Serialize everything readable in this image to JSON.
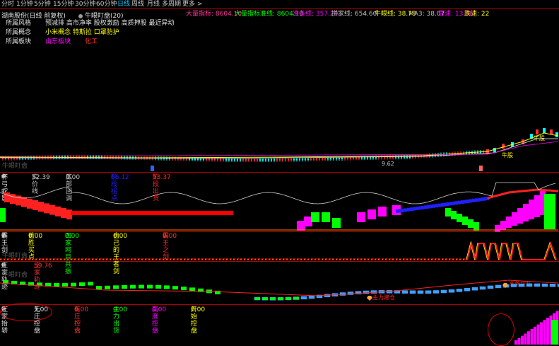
{
  "toolbar": {
    "periods": [
      "分时",
      "1分钟",
      "5分钟",
      "15分钟",
      "30分钟",
      "60分钟",
      "日线",
      "周线",
      "月线",
      "多周期",
      "更多 >"
    ],
    "active": "日线"
  },
  "header": {
    "stock_title": "湖南股份(日线 前复权)",
    "indicator_label": "牛眼盯盘(20)",
    "readouts": [
      {
        "label": "大量指标",
        "value": "8604.10",
        "color": "#ff3399"
      },
      {
        "label": "大量指标准线",
        "value": "8604.10",
        "color": "#00ff00"
      },
      {
        "label": "准备线",
        "value": "357.20",
        "color": "#ff00ff"
      },
      {
        "label": "拼家线",
        "value": "654.60",
        "color": "#c0c0c0"
      },
      {
        "label": "牛眼线",
        "value": "38.78",
        "color": "#ffff00"
      },
      {
        "label": "MA3",
        "value": "38.07",
        "color": "#c0c0c0"
      },
      {
        "label": "涨速",
        "value": "13.76",
        "color": "#ff00ff"
      },
      {
        "label": "跌速",
        "value": "22",
        "color": "#ffff00"
      }
    ]
  },
  "info": {
    "rows": [
      {
        "label": "所属风格",
        "value": "预减排 高市净率 股权激励 高质押股 最近异动",
        "color": "#e0e0e0"
      },
      {
        "label": "所属概念",
        "value": "小米概念 特斯拉 口罩防护",
        "color": "#ffff00"
      },
      {
        "label": "所属板块",
        "value": "山东板块",
        "value2": "化工",
        "color": "#ff00ff",
        "color2": "#ff3030"
      }
    ]
  },
  "main_chart": {
    "watermark": "牛眼盯盘",
    "price_label": "9.62",
    "markers": [
      "牛股",
      "牛股"
    ]
  },
  "panels": [
    {
      "name": "杯弓蛇影",
      "label": "杯弓蛇影",
      "readouts": [
        {
          "label": "实价线",
          "value": "52.39",
          "color": "#c0c0c0"
        },
        {
          "label": "底部回调",
          "value": "0.00",
          "color": "#c0c0c0"
        },
        {
          "label": "阶段拐点",
          "value": "66.12",
          "color": "#0000ff"
        },
        {
          "label": "阶段出货",
          "value": "53.37",
          "color": "#ff2020"
        }
      ]
    },
    {
      "name": "霸王剑",
      "label": "霸王剑",
      "readouts": [
        {
          "label": "首胜买点",
          "value": "0.00",
          "color": "#ffff00"
        },
        {
          "label": "四家网目共振",
          "value": "0.00",
          "color": "#00ff00"
        },
        {
          "label": "自己的王者剑",
          "value": "0.00",
          "color": "#ffff00"
        },
        {
          "label": "霸王之剑",
          "value": "0.00",
          "color": "#ff3030"
        }
      ],
      "watermark": "牛眼盯盘"
    },
    {
      "name": "庄家轨迹",
      "label": "庄家轨迹",
      "readouts": [
        {
          "label": "庄家轨迹",
          "value": "59.76",
          "color": "#ff3030"
        }
      ],
      "watermark": "牛眼盯盘",
      "annotations": [
        "主力建仓",
        "准备拉升"
      ]
    },
    {
      "name": "庄家抬轿",
      "label": "庄家抬轿",
      "readouts": [
        {
          "label": "无庄控盘",
          "value": "1.00",
          "color": "#e0e0e0"
        },
        {
          "label": "有庄控盘",
          "value": "0.00",
          "color": "#ff3030"
        },
        {
          "label": "主力出货",
          "value": "0.00",
          "color": "#00ff00"
        },
        {
          "label": "高度控盘",
          "value": "0.00",
          "color": "#ff00ff"
        },
        {
          "label": "开始控盘",
          "value": "0.00",
          "color": "#ffff00"
        }
      ]
    }
  ]
}
